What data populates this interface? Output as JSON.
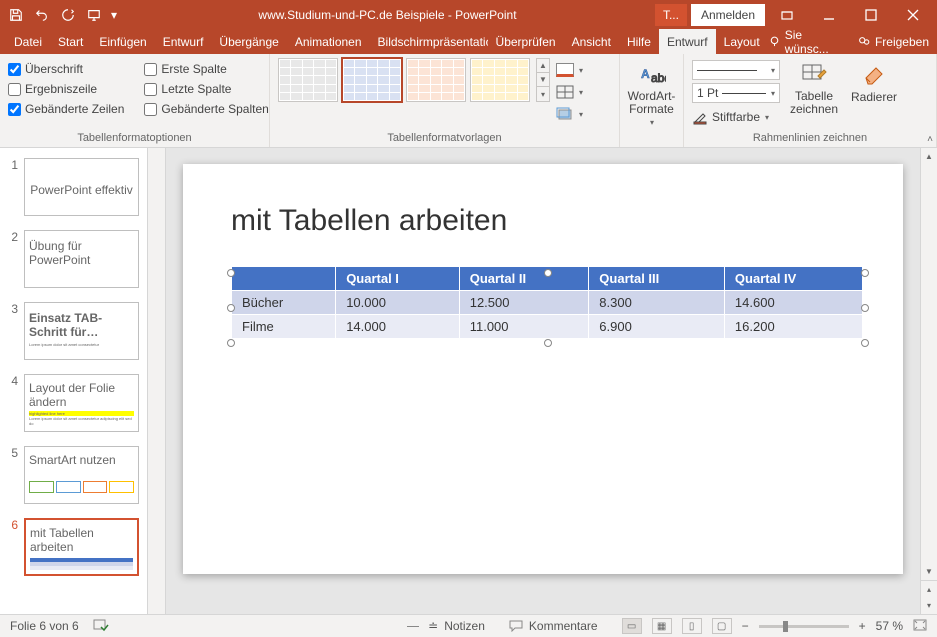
{
  "titlebar": {
    "title": "www.Studium-und-PC.de Beispiele  -  PowerPoint",
    "signin": "Anmelden",
    "tool_tab": "T..."
  },
  "tabs": {
    "items": [
      "Datei",
      "Start",
      "Einfügen",
      "Entwurf",
      "Übergänge",
      "Animationen",
      "Bildschirmpräsentation",
      "Überprüfen",
      "Ansicht",
      "Hilfe",
      "Entwurf",
      "Layout"
    ],
    "tell_me": "Sie wünsc...",
    "share": "Freigeben"
  },
  "ribbon": {
    "opts": {
      "label": "Tabellenformatoptionen",
      "c1": [
        "Überschrift",
        "Ergebniszeile",
        "Gebänderte Zeilen"
      ],
      "c2": [
        "Erste Spalte",
        "Letzte Spalte",
        "Gebänderte Spalten"
      ]
    },
    "styles_label": "Tabellenformatvorlagen",
    "wordart": "WordArt-Formate",
    "borders": {
      "label": "Rahmenlinien zeichnen",
      "weight": "1 Pt",
      "pen": "Stiftfarbe",
      "draw": "Tabelle zeichnen",
      "eraser": "Radierer"
    }
  },
  "thumbs": [
    {
      "n": "1",
      "t": "PowerPoint effektiv"
    },
    {
      "n": "2",
      "t": "Übung für PowerPoint"
    },
    {
      "n": "3",
      "t": "Einsatz TAB-Schritt für…"
    },
    {
      "n": "4",
      "t": "Layout der Folie ändern"
    },
    {
      "n": "5",
      "t": "SmartArt nutzen"
    },
    {
      "n": "6",
      "t": "mit Tabellen arbeiten"
    }
  ],
  "slide": {
    "title": "mit Tabellen arbeiten",
    "headers": [
      "",
      "Quartal I",
      "Quartal II",
      "Quartal III",
      "Quartal IV"
    ],
    "rows": [
      [
        "Bücher",
        "10.000",
        "12.500",
        "8.300",
        "14.600"
      ],
      [
        "Filme",
        "14.000",
        "11.000",
        "6.900",
        "16.200"
      ]
    ]
  },
  "status": {
    "slide": "Folie 6 von 6",
    "notes": "Notizen",
    "comments": "Kommentare",
    "zoom": "57 %"
  }
}
